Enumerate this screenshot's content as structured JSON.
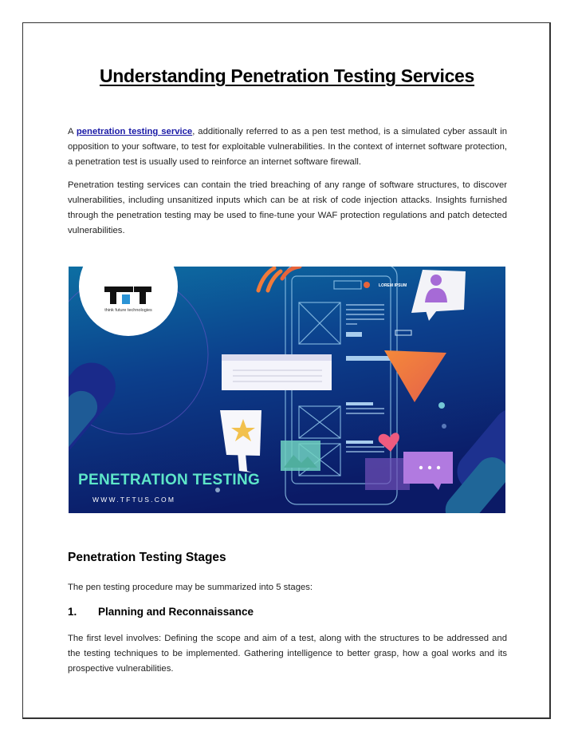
{
  "document": {
    "title": "Understanding Penetration Testing Services",
    "intro": {
      "prefix": "A ",
      "link_text": "penetration testing service",
      "suffix": ", additionally referred to as a pen test method, is a simulated cyber assault in opposition to your software, to test for exploitable vulnerabilities. In the context of internet software protection, a penetration test is usually used to reinforce an internet software firewall."
    },
    "paragraph2": "Penetration testing services can contain the tried breaching of any range of software structures, to discover vulnerabilities, including unsanitized inputs which can be at risk of code injection attacks. Insights furnished through the penetration testing may be used to fine-tune your WAF protection regulations and patch detected vulnerabilities.",
    "banner": {
      "logo_text": "TFT",
      "logo_tagline": "think future technologies",
      "phone_header_text": "LOREM IPSUM",
      "headline": "PENETRATION TESTING",
      "website": "WWW.TFTUS.COM",
      "colors": {
        "bg_top": "#0b5f93",
        "bg_bottom": "#0b1e6b",
        "headline": "#5ee6c8",
        "orange": "#f07a3a",
        "purple": "#a66ad6",
        "heart": "#ef5b7f",
        "star": "#f2c14e"
      }
    },
    "section_heading": "Penetration Testing Stages",
    "section_intro": "The pen testing procedure may be summarized into 5 stages:",
    "stage1": {
      "number": "1.",
      "title": "Planning and Reconnaissance",
      "text": "The first level involves: Defining the scope and aim of a test, along with the structures to be addressed and the testing techniques to be implemented. Gathering intelligence to better grasp, how a goal works and its prospective vulnerabilities."
    }
  }
}
